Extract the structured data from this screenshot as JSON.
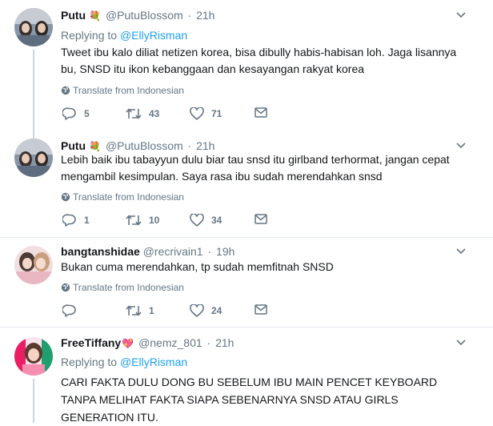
{
  "tweets": [
    {
      "name": "Putu",
      "handle": "@PutuBlossom",
      "separator": "·",
      "time": "21h",
      "replying_prefix": "Replying to ",
      "replying_to": "@EllyRisman",
      "text": "Tweet ibu kalo diliat netizen korea, bisa dibully habis-habisan loh. Jaga lisannya bu, SNSD itu ikon kebanggaan dan kesayangan rakyat korea",
      "translate": "Translate from Indonesian",
      "replies": "5",
      "retweets": "43",
      "likes": "71"
    },
    {
      "name": "Putu",
      "handle": "@PutuBlossom",
      "separator": "·",
      "time": "21h",
      "text": "Lebih baik ibu tabayyun dulu biar tau snsd itu girlband terhormat, jangan cepat mengambil kesimpulan. Saya rasa ibu sudah merendahkan snsd",
      "translate": "Translate from Indonesian",
      "replies": "1",
      "retweets": "10",
      "likes": "34"
    },
    {
      "name": "bangtanshidae",
      "handle": "@recrivain1",
      "separator": "·",
      "time": "19h",
      "text": "Bukan cuma merendahkan, tp sudah memfitnah SNSD",
      "translate": "Translate from Indonesian",
      "replies": "",
      "retweets": "1",
      "likes": "24"
    },
    {
      "name": "FreeTiffany",
      "handle": "@nemz_801",
      "separator": "·",
      "time": "21h",
      "replying_prefix": "Replying to ",
      "replying_to": "@EllyRisman",
      "text": "CARI FAKTA DULU DONG BU SEBELUM IBU MAIN PENCET KEYBOARD TANPA MELIHAT FAKTA SIAPA SEBENARNYA SNSD ATAU GIRLS GENERATION ITU."
    }
  ],
  "colors": {
    "link": "#1da1f2",
    "secondary_text": "#657786",
    "primary_text": "#14171a",
    "divider": "#e6ecf0",
    "heart": "#e0245e"
  },
  "icons": {
    "reply": "reply-icon",
    "retweet": "retweet-icon",
    "like": "heart-icon",
    "dm": "envelope-icon",
    "caret": "chevron-down-icon",
    "globe": "globe-icon",
    "bouquet": "bouquet-emoji",
    "heart_emoji": "sparkling-heart-emoji"
  }
}
